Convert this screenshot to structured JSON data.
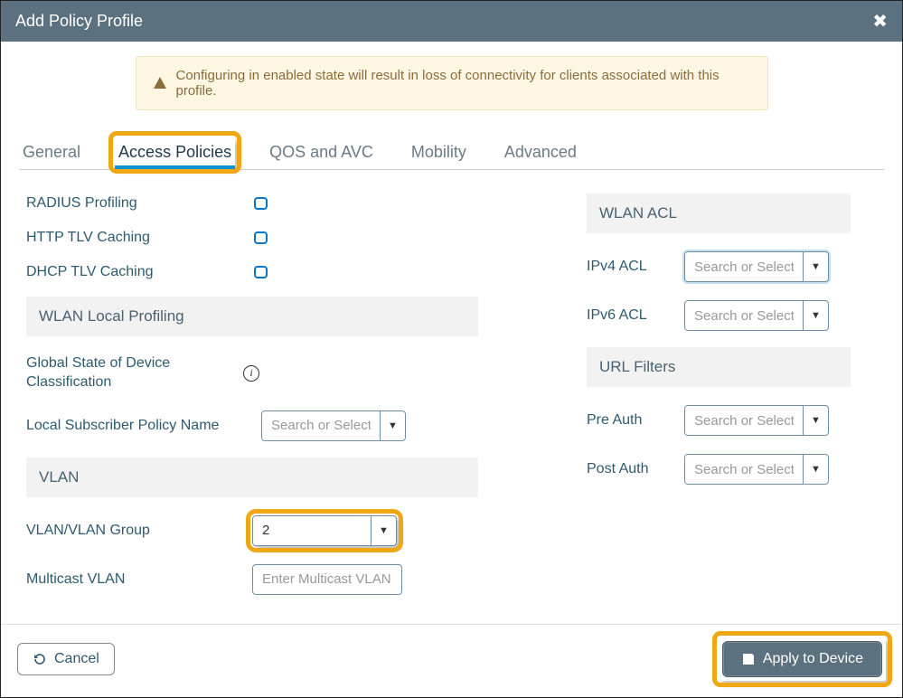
{
  "title": "Add Policy Profile",
  "alert": "Configuring in enabled state will result in loss of connectivity for clients associated with this profile.",
  "tabs": {
    "general": "General",
    "access": "Access Policies",
    "qos": "QOS and AVC",
    "mobility": "Mobility",
    "advanced": "Advanced"
  },
  "labels": {
    "radius": "RADIUS Profiling",
    "httpTlv": "HTTP TLV Caching",
    "dhcpTlv": "DHCP TLV Caching",
    "wlanLocal": "WLAN Local Profiling",
    "globalState": "Global State of Device Classification",
    "localSub": "Local Subscriber Policy Name",
    "vlanHead": "VLAN",
    "vlanGroup": "VLAN/VLAN Group",
    "mcastVlan": "Multicast VLAN",
    "wlanAcl": "WLAN ACL",
    "ipv4": "IPv4 ACL",
    "ipv6": "IPv6 ACL",
    "urlFilters": "URL Filters",
    "preAuth": "Pre Auth",
    "postAuth": "Post Auth"
  },
  "placeholders": {
    "search": "Search or Select",
    "mcast": "Enter Multicast VLAN"
  },
  "values": {
    "vlan": "2"
  },
  "buttons": {
    "cancel": "Cancel",
    "apply": "Apply to Device"
  }
}
